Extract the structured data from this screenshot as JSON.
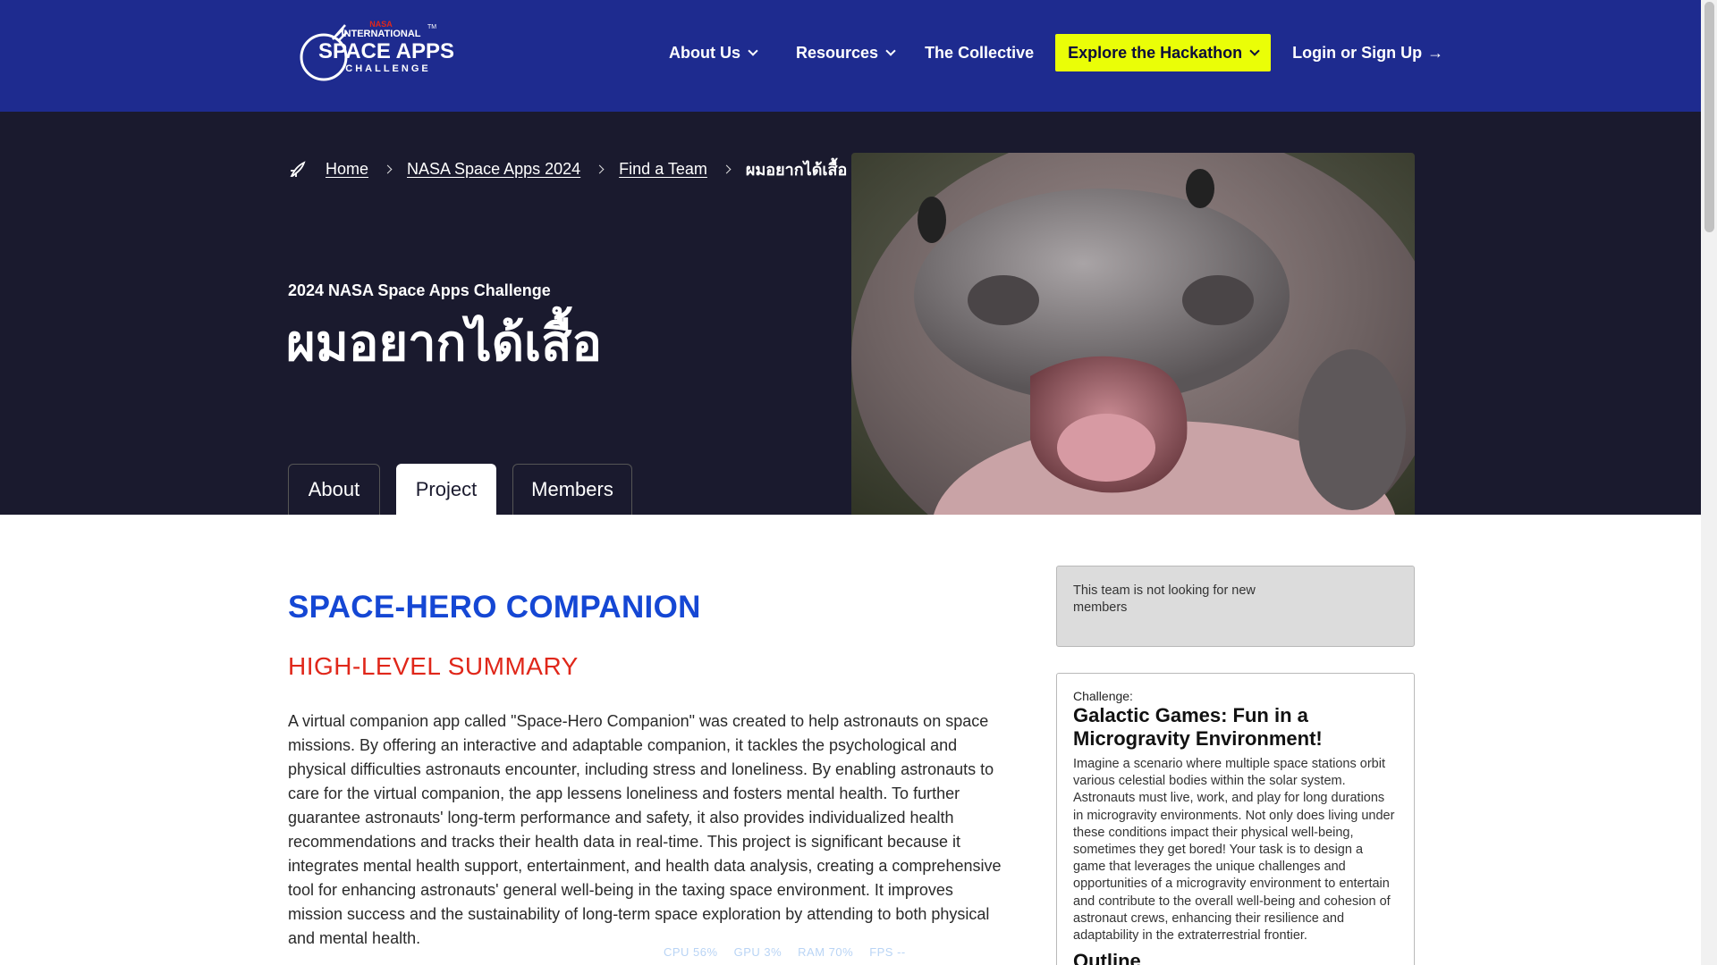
{
  "header": {
    "logo_alt": "NASA International Space Apps Challenge",
    "nav": {
      "about_us": "About Us",
      "resources": "Resources",
      "collective": "The Collective",
      "explore": "Explore the Hackathon",
      "login": "Login or Sign Up"
    }
  },
  "breadcrumb": {
    "home": "Home",
    "event": "NASA Space Apps 2024",
    "find_team": "Find a Team",
    "current": "ผมอยากได้เสื้อ"
  },
  "hero": {
    "eyebrow": "2024 NASA Space Apps Challenge",
    "team_name": "ผมอยากได้เสื้อ",
    "tabs": {
      "about": "About",
      "project": "Project",
      "members": "Members"
    },
    "active_tab": "Project"
  },
  "project": {
    "title": "SPACE-HERO COMPANION",
    "summary_heading": "HIGH-LEVEL SUMMARY",
    "summary": "A virtual companion app called \"Space-Hero Companion\" was created to help astronauts on space missions. By offering an interactive and adaptable companion, it tackles the psychological and physical difficulties astronauts encounter, including stress and loneliness. By enabling astronauts to care for the virtual companion, the app lessens loneliness and fosters mental health. To further guarantee astronauts' long-term performance and safety, it also provides individualized health recommendations and tracks their health data in real-time. This project is significant because it integrates mental health support, entertainment, and health data analysis, creating a comprehensive tool for enhancing astronauts' general well-being in the taxing space environment. It improves mission success and the sustainability of long-term space exploration by attending to both physical and mental health."
  },
  "sidebar": {
    "status": "This team is not looking for new members",
    "challenge_label": "Challenge:",
    "challenge_title": "Galactic Games: Fun in a Microgravity Environment!",
    "challenge_desc": "Imagine a scenario where multiple space stations orbit various celestial bodies within the solar system. Astronauts must live, work, and play for long durations in microgravity environments. Not only does living under these conditions impact their physical well-being, sometimes they get bored! Your task is to design a game that leverages the unique challenges and opportunities of a microgravity environment to entertain and contribute to the overall well-being and cohesion of astronaut crews, enhancing their resilience and adaptability in the extraterrestrial frontier.",
    "outline_heading": "Outline"
  },
  "perf_overlay": {
    "cpu": "CPU  56%",
    "gpu": "GPU  3%",
    "ram": "RAM  70%",
    "fps": "FPS  --"
  },
  "colors": {
    "header_bg": "#1e2b8f",
    "hero_bg": "#1a1a2e",
    "accent_yellow": "#eafe07",
    "title_blue": "#1547d4",
    "heading_red": "#e0271a"
  }
}
